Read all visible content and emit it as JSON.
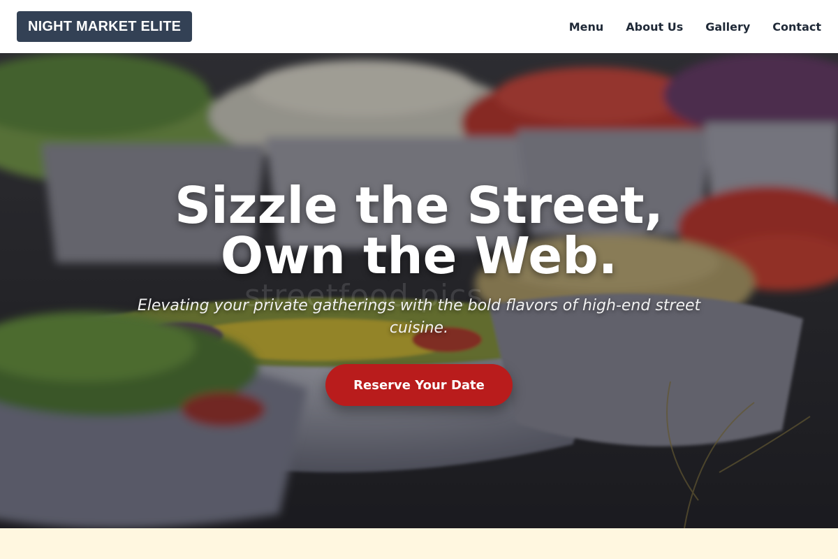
{
  "header": {
    "logo_text": "NIGHT MARKET ELITE",
    "nav": [
      {
        "label": "Menu"
      },
      {
        "label": "About Us"
      },
      {
        "label": "Gallery"
      },
      {
        "label": "Contact"
      }
    ]
  },
  "hero": {
    "title_line1": "Sizzle the Street,",
    "title_line2": "Own the Web.",
    "watermark": "streetfood.pics",
    "subtitle": "Elevating your private gatherings with the bold flavors of high-end street cuisine.",
    "cta_label": "Reserve Your Date"
  },
  "colors": {
    "logo_bg": "#334155",
    "cta_bg": "#b91c1c",
    "next_section_bg": "#fff7e0"
  }
}
